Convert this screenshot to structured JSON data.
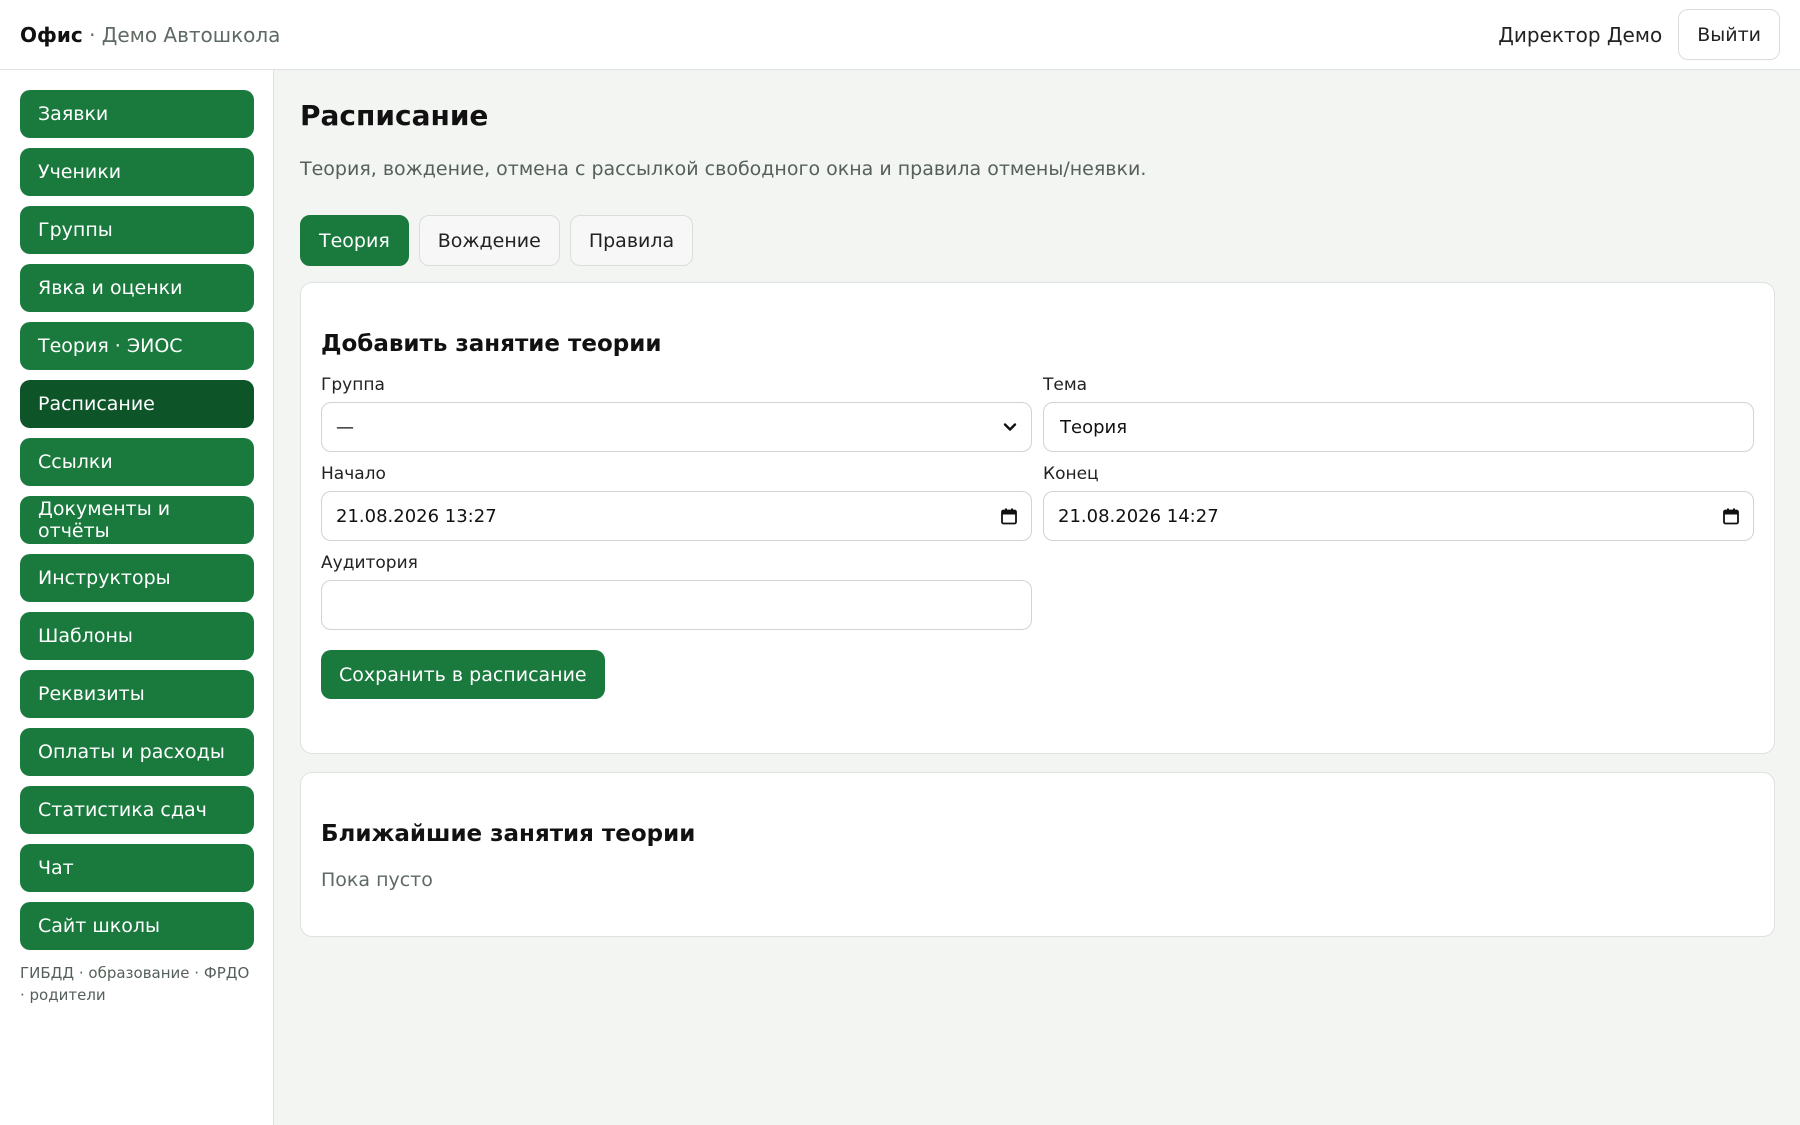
{
  "header": {
    "brand": "Офис",
    "separator": " · ",
    "school": "Демо Автошкола",
    "user": "Директор Демо",
    "logout_label": "Выйти"
  },
  "sidebar": {
    "items": [
      {
        "label": "Заявки"
      },
      {
        "label": "Ученики"
      },
      {
        "label": "Группы"
      },
      {
        "label": "Явка и оценки"
      },
      {
        "label": "Теория · ЭИОС"
      },
      {
        "label": "Расписание",
        "active": true
      },
      {
        "label": "Ссылки"
      },
      {
        "label": "Документы и отчёты"
      },
      {
        "label": "Инструкторы"
      },
      {
        "label": "Шаблоны"
      },
      {
        "label": "Реквизиты"
      },
      {
        "label": "Оплаты и расходы"
      },
      {
        "label": "Статистика сдач"
      },
      {
        "label": "Чат"
      },
      {
        "label": "Сайт школы"
      }
    ],
    "footer": "ГИБДД · образование · ФРДО · родители"
  },
  "main": {
    "title": "Расписание",
    "subtitle": "Теория, вождение, отмена с рассылкой свободного окна и правила отмены/неявки.",
    "tabs": [
      {
        "label": "Теория",
        "active": true
      },
      {
        "label": "Вождение"
      },
      {
        "label": "Правила"
      }
    ],
    "form": {
      "title": "Добавить занятие теории",
      "group_label": "Группа",
      "group_value": "—",
      "topic_label": "Тема",
      "topic_value": "Теория",
      "start_label": "Начало",
      "start_value": "21.08.2026 13:27",
      "end_label": "Конец",
      "end_value": "21.08.2026 14:27",
      "room_label": "Аудитория",
      "room_value": "",
      "save_label": "Сохранить в расписание"
    },
    "upcoming": {
      "title": "Ближайшие занятия теории",
      "empty": "Пока пусто"
    }
  },
  "colors": {
    "accent": "#1a7a3e",
    "accent_active": "#0e5429",
    "background": "#f3f5f3"
  },
  "icons": {
    "select": "chevron-down-icon",
    "date": "calendar-icon"
  }
}
